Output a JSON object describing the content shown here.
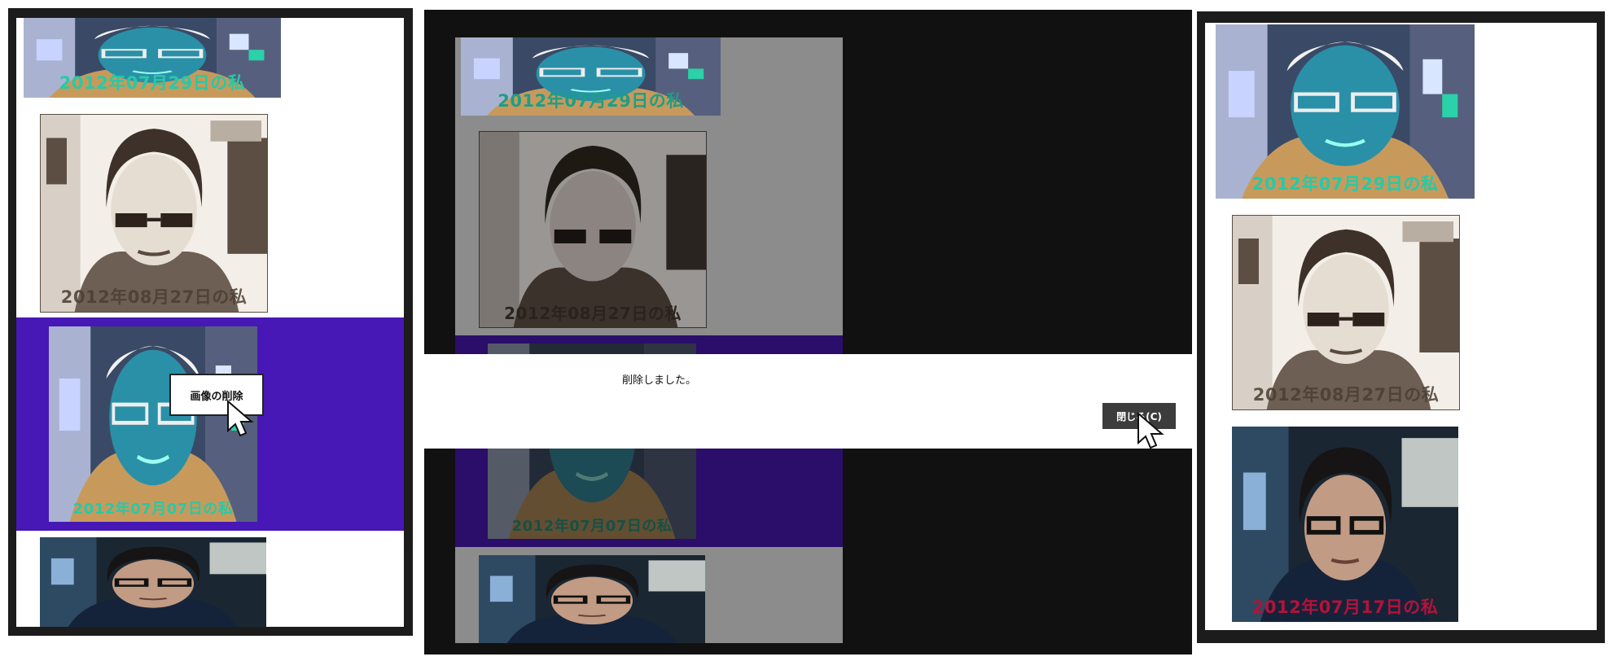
{
  "captions": {
    "c0729": "2012年07月29日の私",
    "c0827": "2012年08月27日の私",
    "c0707": "2012年07月07日の私",
    "c0717": "2012年07月17日の私"
  },
  "context_menu": {
    "delete_label": "画像の削除"
  },
  "dialog": {
    "message": "削除しました。",
    "close_label": "閉じる(C)"
  },
  "colors": {
    "selection": "#4718b5",
    "caption_teal": "#27c9a8",
    "caption_red": "#b4123a",
    "frame": "#1c1c1c"
  }
}
